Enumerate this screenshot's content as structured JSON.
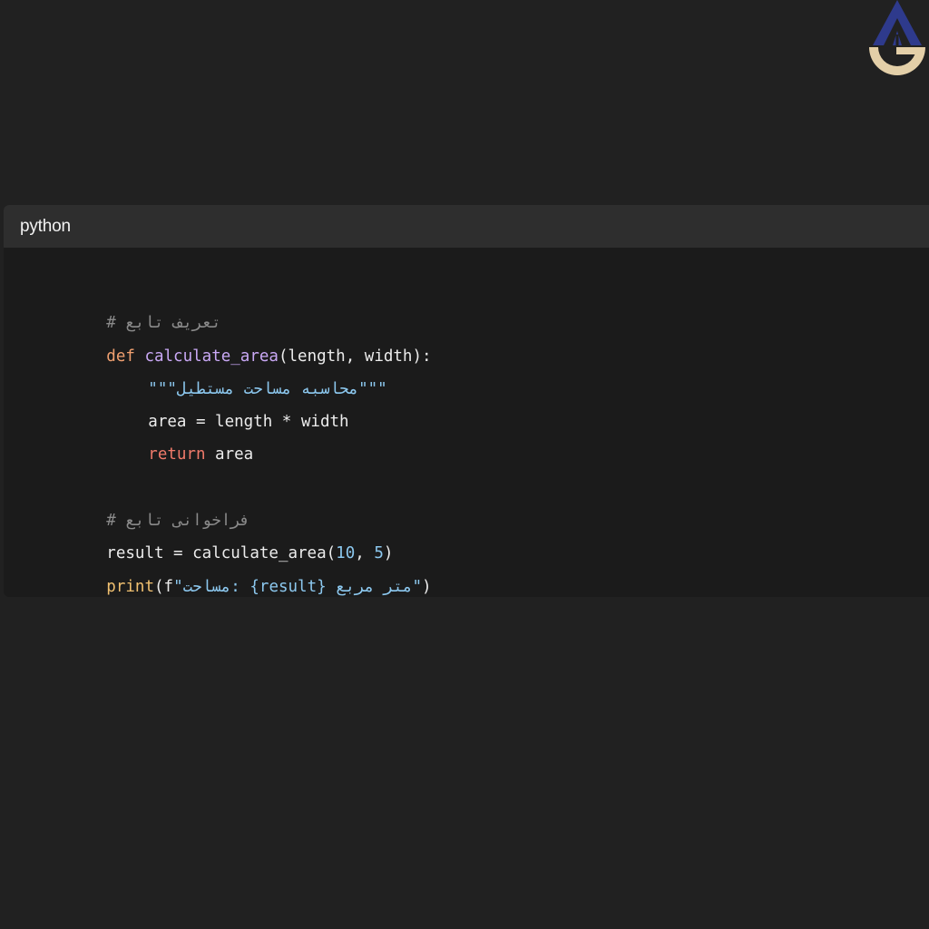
{
  "code_block": {
    "language": "python",
    "lines": {
      "l1": {
        "comment": "# تعریف تابع"
      },
      "l2": {
        "kw": "def",
        "space": " ",
        "fn": "calculate_area",
        "rest": "(length, width):"
      },
      "l3": {
        "str": "\"\"\"محاسبه مساحت مستطیل\"\"\""
      },
      "l4": {
        "plain": "area = length * width"
      },
      "l5": {
        "kw": "return",
        "rest": " area"
      },
      "l6": {},
      "l7": {
        "comment": "# فراخوانی تابع"
      },
      "l8": {
        "plain": "result = calculate_area(",
        "n1": "10",
        "sep": ", ",
        "n2": "5",
        "close": ")"
      },
      "l9": {
        "fn": "print",
        "open": "(f",
        "str": "\"مساحت: {result} متر مربع\"",
        "close": ")"
      }
    }
  },
  "colors": {
    "page_bg": "#212121",
    "header_bg": "#2e2e2e",
    "panel_bg": "#1b1b1b",
    "keyword": "#f0a070",
    "function": "#c9a8f5",
    "string": "#8cc8ef",
    "comment": "#8a8a8a",
    "logo_blue": "#2e3a8c",
    "logo_tan": "#e3cfa8"
  },
  "logo": {
    "icon": "brand-logo-icon"
  }
}
